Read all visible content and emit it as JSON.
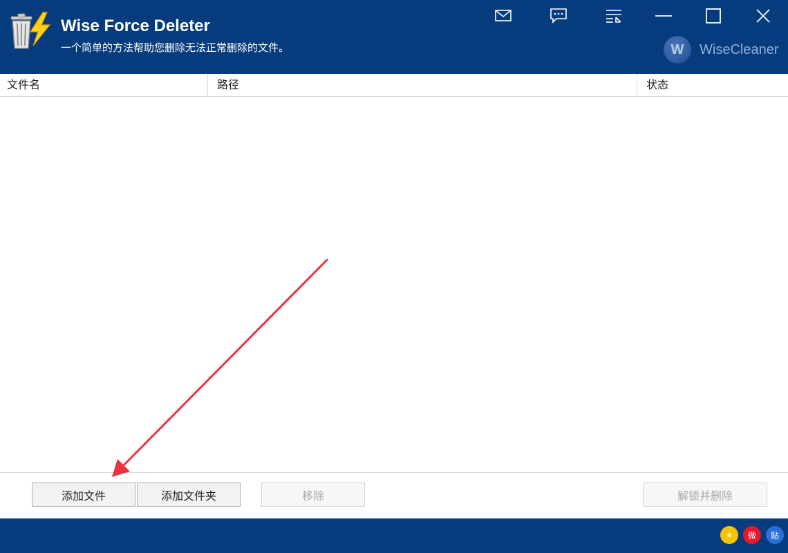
{
  "app": {
    "title": "Wise Force Deleter",
    "subtitle": "一个简单的方法帮助您删除无法正常删除的文件。",
    "brand": "WiseCleaner",
    "brand_logo_letter": "W"
  },
  "titlebar_buttons": [
    {
      "name": "mail-icon"
    },
    {
      "name": "feedback-icon"
    },
    {
      "name": "menu-icon"
    },
    {
      "name": "minimize-icon"
    },
    {
      "name": "maximize-icon"
    },
    {
      "name": "close-icon"
    }
  ],
  "table": {
    "columns": [
      "文件名",
      "路径",
      "状态"
    ],
    "rows": []
  },
  "buttons": {
    "add_file": "添加文件",
    "add_folder": "添加文件夹",
    "remove": "移除",
    "unlock_delete": "解锁并删除"
  },
  "social": [
    {
      "name": "star-icon",
      "glyph": "★",
      "color": "#f5c400"
    },
    {
      "name": "weibo-icon",
      "glyph": "微",
      "color": "#e6162d"
    },
    {
      "name": "tieba-icon",
      "glyph": "贴",
      "color": "#2b6fd6"
    }
  ],
  "colors": {
    "titlebar": "#063c7e",
    "annotation_arrow": "#e8353b"
  }
}
